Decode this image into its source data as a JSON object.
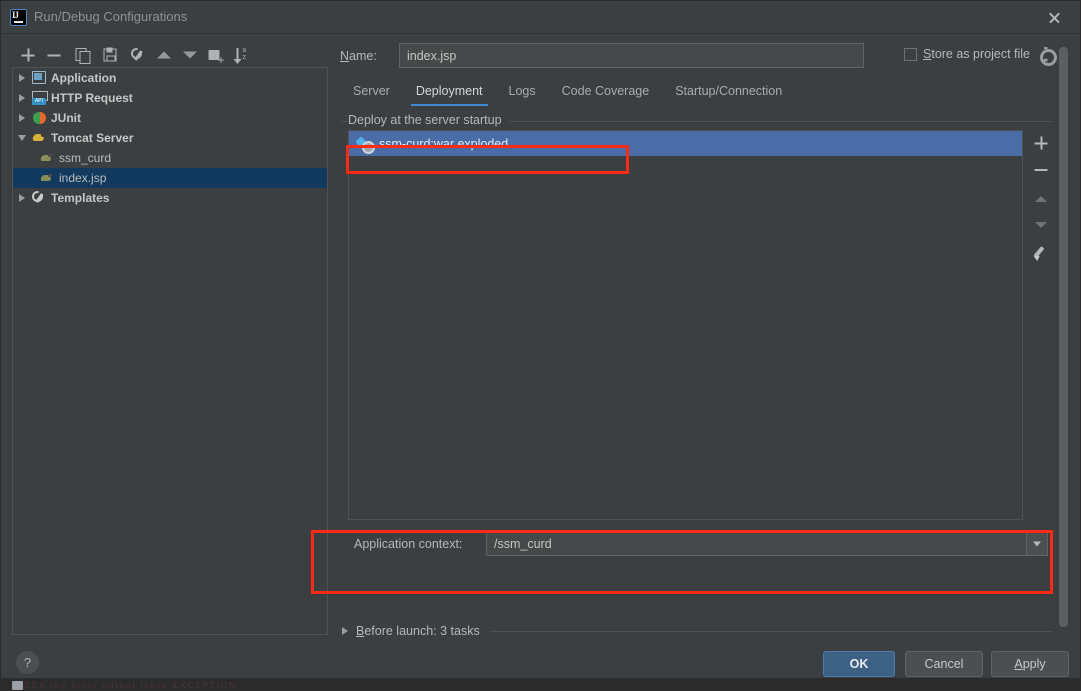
{
  "window": {
    "title": "Run/Debug Configurations",
    "logo_text": "IJ",
    "close_icon": "close-icon"
  },
  "toolbar": {
    "buttons": [
      {
        "name": "add",
        "icon": "plus-icon"
      },
      {
        "name": "remove",
        "icon": "minus-icon"
      },
      {
        "name": "copy",
        "icon": "copy-icon"
      },
      {
        "name": "save",
        "icon": "save-icon"
      },
      {
        "name": "edit-templates",
        "icon": "wrench-icon"
      },
      {
        "name": "move-up",
        "icon": "arrow-up-icon"
      },
      {
        "name": "move-down",
        "icon": "arrow-down-icon"
      },
      {
        "name": "new-folder",
        "icon": "new-folder-icon"
      },
      {
        "name": "sort-alphabetically",
        "icon": "sort-az-icon"
      }
    ]
  },
  "tree": {
    "items": [
      {
        "label": "Application",
        "icon": "application-icon",
        "expanded": false,
        "group": true,
        "child": false,
        "selected": false
      },
      {
        "label": "HTTP Request",
        "icon": "http-request-icon",
        "expanded": false,
        "group": true,
        "child": false,
        "selected": false
      },
      {
        "label": "JUnit",
        "icon": "junit-icon",
        "expanded": false,
        "group": true,
        "child": false,
        "selected": false
      },
      {
        "label": "Tomcat Server",
        "icon": "tomcat-icon",
        "expanded": true,
        "group": true,
        "child": false,
        "selected": false
      },
      {
        "label": "ssm_curd",
        "icon": "tomcat-config-icon",
        "expanded": null,
        "group": false,
        "child": true,
        "selected": false
      },
      {
        "label": "index.jsp",
        "icon": "tomcat-config-icon",
        "expanded": null,
        "group": false,
        "child": true,
        "selected": true
      },
      {
        "label": "Templates",
        "icon": "templates-icon",
        "expanded": false,
        "group": true,
        "child": false,
        "selected": false
      }
    ]
  },
  "help": {
    "label": "?"
  },
  "form": {
    "name_label": "Name:",
    "name_label_mnemonic": "N",
    "name_value": "index.jsp",
    "store_as_project_file": "Store as project file",
    "store_mnemonic": "S",
    "store_checked": false,
    "gear_icon": "gear-icon"
  },
  "tabs": [
    {
      "label": "Server",
      "active": false
    },
    {
      "label": "Deployment",
      "active": true
    },
    {
      "label": "Logs",
      "active": false
    },
    {
      "label": "Code Coverage",
      "active": false
    },
    {
      "label": "Startup/Connection",
      "active": false
    }
  ],
  "deployment": {
    "group_title": "Deploy at the server startup",
    "rows": [
      {
        "label": "ssm-curd:war exploded",
        "icon": "artifact-icon",
        "selected": true
      }
    ],
    "side_buttons": [
      {
        "name": "add-artifact",
        "icon": "plus-icon"
      },
      {
        "name": "remove-artifact",
        "icon": "minus-icon"
      },
      {
        "name": "move-up",
        "icon": "arrow-up-icon"
      },
      {
        "name": "move-down",
        "icon": "arrow-down-icon"
      },
      {
        "name": "edit-artifact",
        "icon": "pencil-icon"
      }
    ],
    "context_label": "Application context:",
    "context_value": "/ssm_curd",
    "context_dropdown_icon": "chevron-down-icon"
  },
  "before_launch": {
    "label": "Before launch: 3 tasks",
    "mnemonic": "B",
    "expanded": false,
    "expand_icon": "triangle-right-icon"
  },
  "actions": {
    "ok": "OK",
    "cancel": "Cancel",
    "apply": "Apply",
    "apply_mnemonic": "A"
  },
  "colors": {
    "window_bg": "#3c3f41",
    "selection_blue": "#4a6da7",
    "tree_selection": "#123a5f",
    "tab_accent": "#3f87d0",
    "annotation_red": "#f92b16",
    "ok_button": "#3d6185"
  },
  "bottom_strip": {
    "ghost_text": "IDEA  log  error  output  trace  EXCEPTION"
  }
}
